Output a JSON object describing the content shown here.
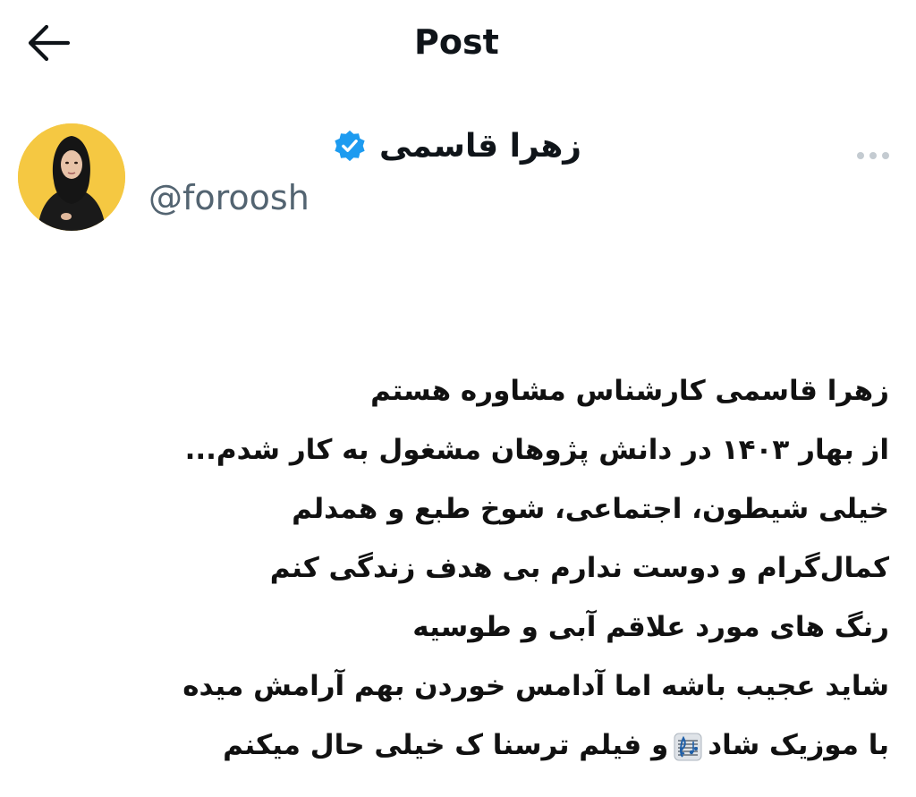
{
  "header": {
    "back_icon": "arrow-left-icon",
    "title": "Post"
  },
  "author": {
    "display_name": "زهرا قاسمی",
    "verified_icon": "verified-badge-icon",
    "verified_color": "#1d9bf0",
    "handle": "@foroosh",
    "avatar_bg": "#f5c842"
  },
  "more_icon": "more-horizontal-icon",
  "bio": {
    "lines": [
      "زهرا قاسمی کارشناس مشاوره هستم",
      "از بهار ۱۴۰۳ در دانش پژوهان مشغول به کار شدم...",
      "خیلی شیطون، اجتماعی، شوخ طبع و همدلم",
      "کمال‌گرام و دوست ندارم بی هدف زندگی کنم",
      "رنگ های مورد علاقم آبی و طوسیه",
      "شاید عجیب باشه اما آدامس خوردن بهم آرامش میده"
    ],
    "last_line_start": "با موزیک شاد",
    "last_line_end": "و فیلم ترسنا ک خیلی حال میکنم",
    "music_icon": "musical-score-icon"
  }
}
